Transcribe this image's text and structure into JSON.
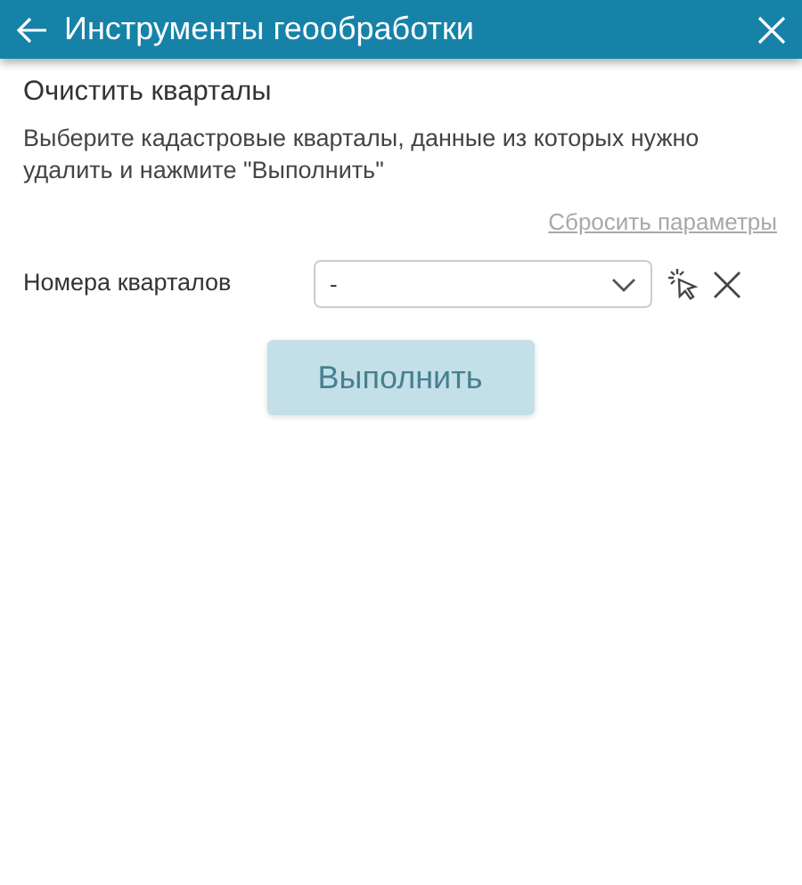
{
  "header": {
    "title": "Инструменты геообработки"
  },
  "tool": {
    "title": "Очистить кварталы",
    "description": "Выберите кадастровые кварталы, данные из которых нужно удалить и нажмите \"Выполнить\""
  },
  "reset_link": "Сбросить параметры",
  "field": {
    "label": "Номера кварталов",
    "value": "-"
  },
  "run_button": {
    "label": "Выполнить",
    "disabled": true
  }
}
